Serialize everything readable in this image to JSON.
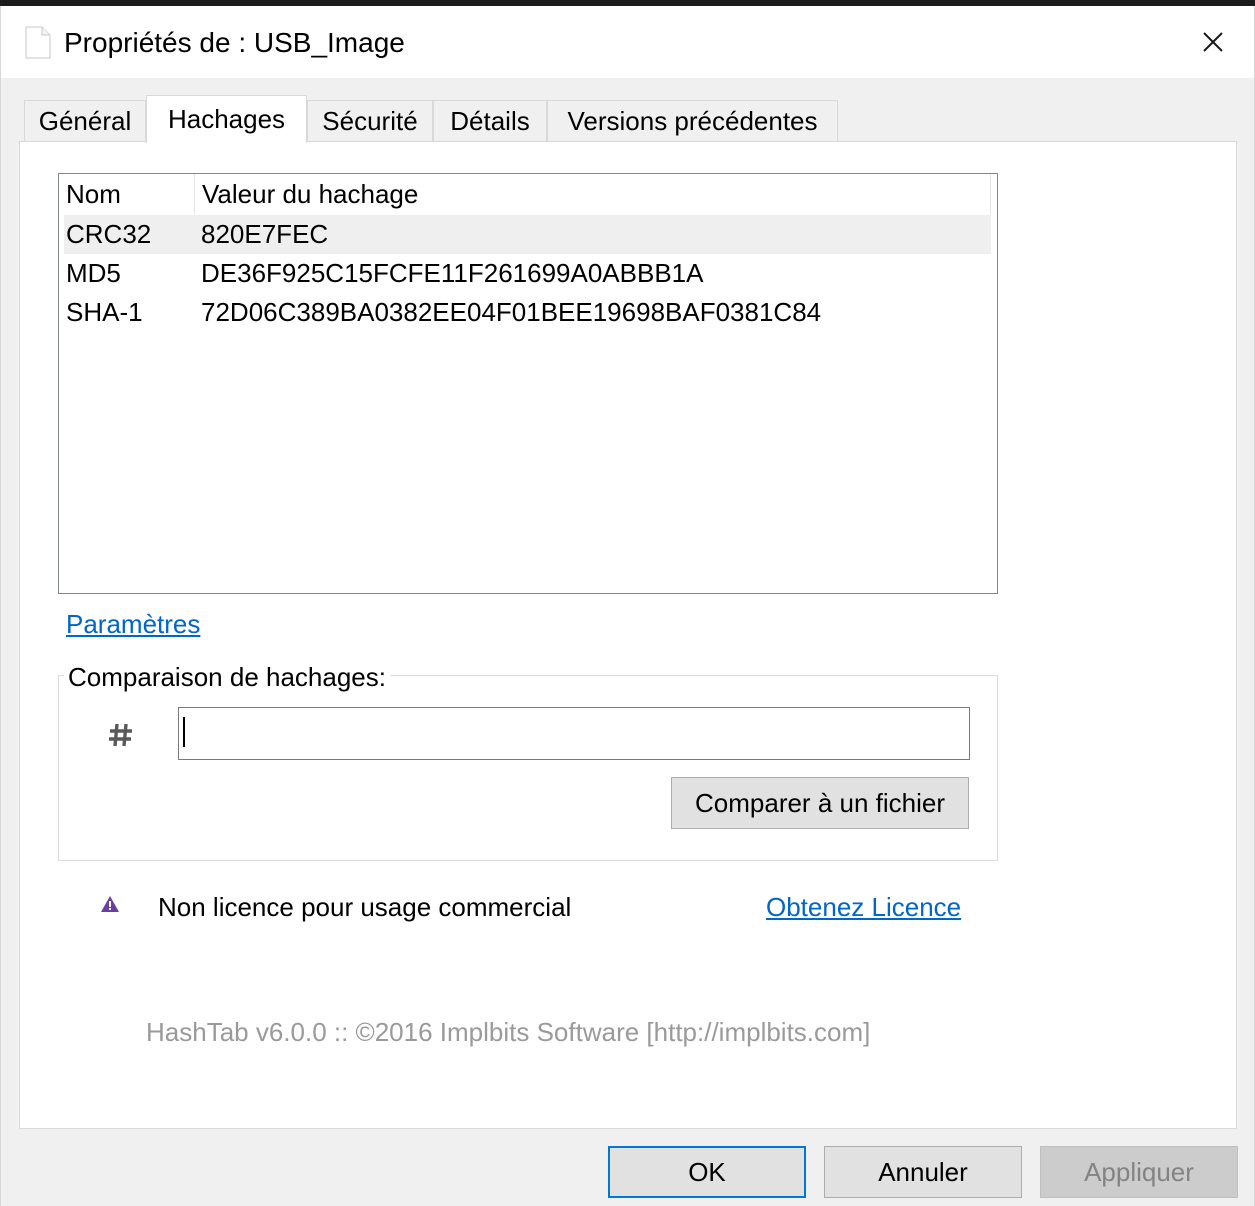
{
  "window": {
    "title": "Propriétés de : USB_Image"
  },
  "tabs": [
    {
      "label": "Général",
      "active": false
    },
    {
      "label": "Hachages",
      "active": true
    },
    {
      "label": "Sécurité",
      "active": false
    },
    {
      "label": "Détails",
      "active": false
    },
    {
      "label": "Versions précédentes",
      "active": false
    }
  ],
  "hash_list": {
    "columns": [
      "Nom",
      "Valeur du hachage"
    ],
    "rows": [
      {
        "name": "CRC32",
        "value": "820E7FEC",
        "selected": true
      },
      {
        "name": "MD5",
        "value": "DE36F925C15FCFE11F261699A0ABBB1A",
        "selected": false
      },
      {
        "name": "SHA-1",
        "value": "72D06C389BA0382EE04F01BEE19698BAF0381C84",
        "selected": false
      }
    ]
  },
  "settings_link": "Paramètres",
  "comparison": {
    "title": "Comparaison de hachages:",
    "input_value": "",
    "compare_button": "Comparer à un fichier"
  },
  "license": {
    "message": "Non licence pour usage commercial",
    "link": "Obtenez Licence"
  },
  "footer": "HashTab v6.0.0 :: ©2016 Implbits Software [http://implbits.com]",
  "buttons": {
    "ok": "OK",
    "cancel": "Annuler",
    "apply": "Appliquer"
  },
  "icons": {
    "file": "file-icon",
    "close": "close-icon",
    "hash": "hash-icon",
    "warning": "warning-icon"
  },
  "colors": {
    "link": "#0066cc",
    "ok_border": "#0078d7",
    "warning": "#6b3fa0",
    "footer_text": "#9a9a9a"
  }
}
